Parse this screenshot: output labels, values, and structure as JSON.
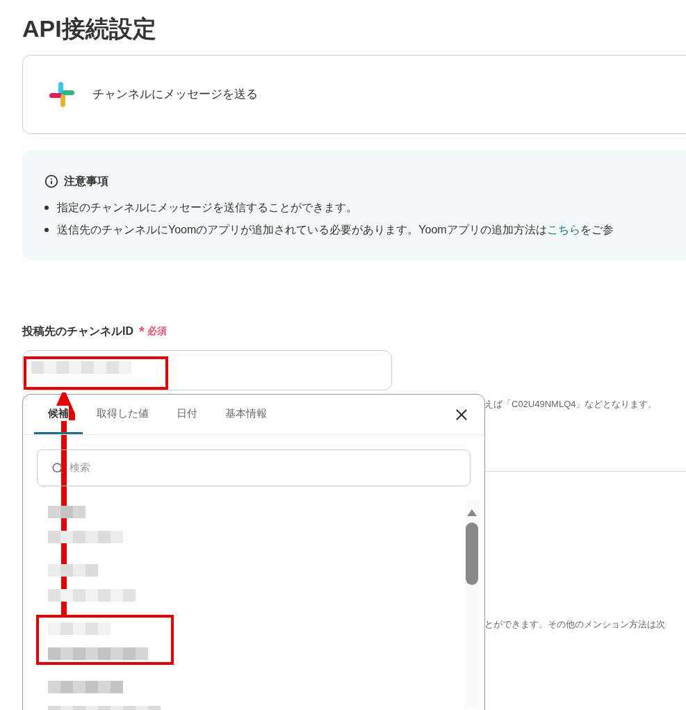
{
  "page_title": "API接続設定",
  "action": {
    "label": "チャンネルにメッセージを送る"
  },
  "notice": {
    "title": "注意事項",
    "items": [
      {
        "text": "指定のチャンネルにメッセージを送信することができます。"
      },
      {
        "text": "送信先のチャンネルにYoomのアプリが追加されている必要があります。Yoomアプリの追加方法は",
        "link": "こちら",
        "after": "をご参"
      }
    ]
  },
  "field": {
    "label": "投稿先のチャンネルID",
    "required_mark": "*",
    "required": "必須",
    "hint": "えば「C02U49NMLQ4」などとなります。"
  },
  "mention_hint": "とができます。その他のメンション方法は次",
  "popup": {
    "tabs": [
      {
        "label": "候補",
        "selected": true
      },
      {
        "label": "取得した値",
        "selected": false
      },
      {
        "label": "日付",
        "selected": false
      },
      {
        "label": "基本情報",
        "selected": false
      }
    ],
    "search": {
      "placeholder": "検索"
    }
  }
}
